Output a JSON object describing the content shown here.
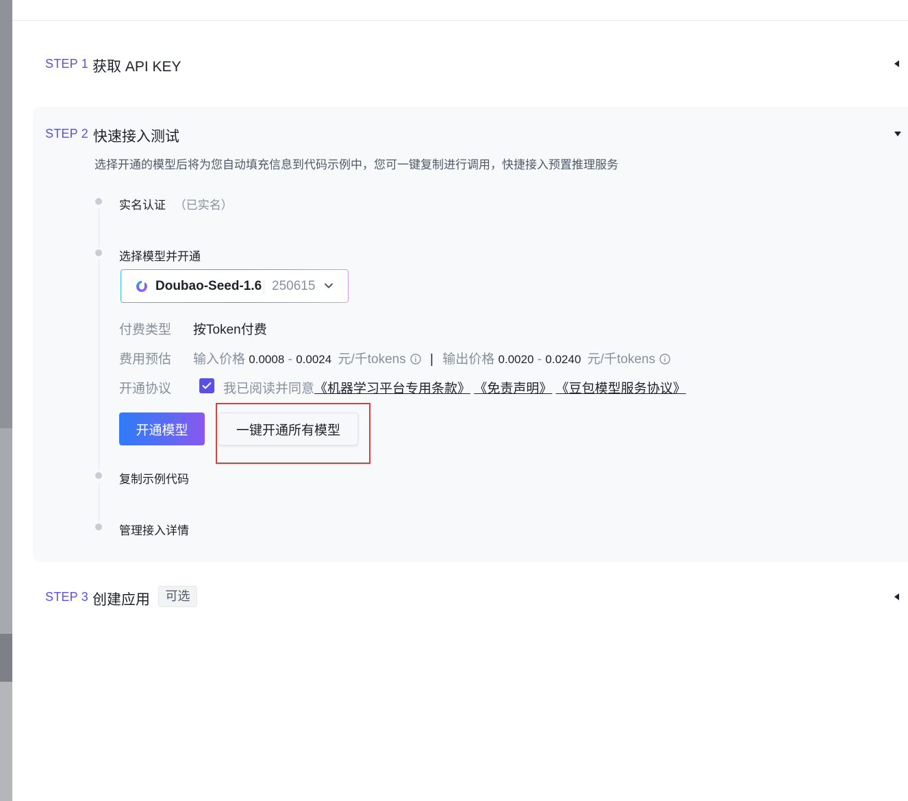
{
  "steps": [
    {
      "label": "STEP 1",
      "title": "获取 API KEY",
      "expanded": false
    },
    {
      "label": "STEP 2",
      "title": "快速接入测试",
      "expanded": true,
      "description": "选择开通的模型后将为您自动填充信息到代码示例中，您可一键复制进行调用，快捷接入预置推理服务"
    },
    {
      "label": "STEP 3",
      "title": "创建应用",
      "tag": "可选",
      "expanded": false
    }
  ],
  "timeline": {
    "realname": {
      "title": "实名认证",
      "status": "（已实名）"
    },
    "select_model": {
      "title": "选择模型并开通"
    },
    "copy_code": {
      "title": "复制示例代码"
    },
    "manage": {
      "title": "管理接入详情"
    }
  },
  "model_select": {
    "name": "Doubao-Seed-1.6",
    "version": "250615",
    "logo_icon": "doubao-logo-icon",
    "dropdown_icon": "chevron-down-icon"
  },
  "billing": {
    "type_label": "付费类型",
    "type_value": "按Token付费",
    "estimate_label": "费用预估",
    "input_label": "输入价格",
    "input_min": "0.0008",
    "input_max": "0.0024",
    "unit": "元/千tokens",
    "separator": "|",
    "output_label": "输出价格",
    "output_min": "0.0020",
    "output_max": "0.0240",
    "dash": "-"
  },
  "agreement": {
    "label": "开通协议",
    "checked": true,
    "prefix": "我已阅读并同意",
    "link1": "《机器学习平台专用条款》",
    "link2": "《免责声明》",
    "link3": "《豆包模型服务协议》"
  },
  "buttons": {
    "activate": "开通模型",
    "activate_all": "一键开通所有模型"
  },
  "colors": {
    "accent": "#5b50e6",
    "highlight": "#e53a3a"
  }
}
